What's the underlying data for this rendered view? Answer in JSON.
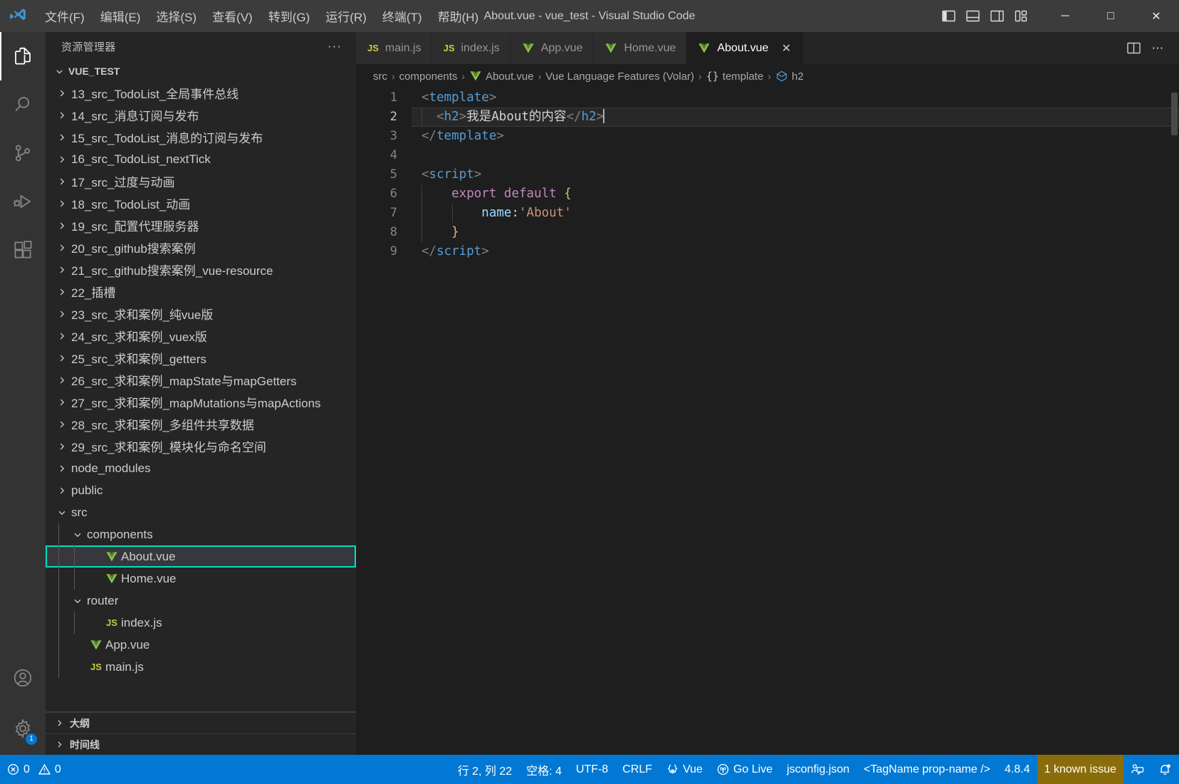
{
  "titlebar": {
    "title": "About.vue - vue_test - Visual Studio Code",
    "menus": [
      "文件(F)",
      "编辑(E)",
      "选择(S)",
      "查看(V)",
      "转到(G)",
      "运行(R)",
      "终端(T)",
      "帮助(H)"
    ],
    "layout_buttons": [
      {
        "name": "toggle-primary-sidebar",
        "label": "切换主侧栏"
      },
      {
        "name": "toggle-panel",
        "label": "切换面板"
      },
      {
        "name": "toggle-secondary-sidebar",
        "label": "切换辅助侧栏"
      },
      {
        "name": "customize-layout",
        "label": "自定义布局"
      }
    ],
    "window_buttons": [
      {
        "name": "minimize",
        "glyph": "─"
      },
      {
        "name": "maximize",
        "glyph": "□"
      },
      {
        "name": "close",
        "glyph": "✕"
      }
    ]
  },
  "activitybar": {
    "items": [
      {
        "name": "explorer",
        "icon": "files-icon",
        "active": true
      },
      {
        "name": "search",
        "icon": "search-icon",
        "active": false
      },
      {
        "name": "source-control",
        "icon": "source-control-icon",
        "active": false
      },
      {
        "name": "run-and-debug",
        "icon": "run-debug-icon",
        "active": false
      },
      {
        "name": "extensions",
        "icon": "extensions-icon",
        "active": false
      }
    ],
    "bottom": [
      {
        "name": "accounts",
        "icon": "account-icon",
        "badge": ""
      },
      {
        "name": "manage",
        "icon": "gear-icon",
        "badge": "1"
      }
    ]
  },
  "sidebar": {
    "header": "资源管理器",
    "more_actions": "···",
    "root": "VUE_TEST",
    "tree": [
      {
        "label": "13_src_TodoList_全局事件总线",
        "kind": "folder",
        "expanded": false,
        "depth": 1
      },
      {
        "label": "14_src_消息订阅与发布",
        "kind": "folder",
        "expanded": false,
        "depth": 1
      },
      {
        "label": "15_src_TodoList_消息的订阅与发布",
        "kind": "folder",
        "expanded": false,
        "depth": 1
      },
      {
        "label": "16_src_TodoList_nextTick",
        "kind": "folder",
        "expanded": false,
        "depth": 1
      },
      {
        "label": "17_src_过度与动画",
        "kind": "folder",
        "expanded": false,
        "depth": 1
      },
      {
        "label": "18_src_TodoList_动画",
        "kind": "folder",
        "expanded": false,
        "depth": 1
      },
      {
        "label": "19_src_配置代理服务器",
        "kind": "folder",
        "expanded": false,
        "depth": 1
      },
      {
        "label": "20_src_github搜索案例",
        "kind": "folder",
        "expanded": false,
        "depth": 1
      },
      {
        "label": "21_src_github搜索案例_vue-resource",
        "kind": "folder",
        "expanded": false,
        "depth": 1
      },
      {
        "label": "22_插槽",
        "kind": "folder",
        "expanded": false,
        "depth": 1
      },
      {
        "label": "23_src_求和案例_纯vue版",
        "kind": "folder",
        "expanded": false,
        "depth": 1
      },
      {
        "label": "24_src_求和案例_vuex版",
        "kind": "folder",
        "expanded": false,
        "depth": 1
      },
      {
        "label": "25_src_求和案例_getters",
        "kind": "folder",
        "expanded": false,
        "depth": 1
      },
      {
        "label": "26_src_求和案例_mapState与mapGetters",
        "kind": "folder",
        "expanded": false,
        "depth": 1
      },
      {
        "label": "27_src_求和案例_mapMutations与mapActions",
        "kind": "folder",
        "expanded": false,
        "depth": 1
      },
      {
        "label": "28_src_求和案例_多组件共享数据",
        "kind": "folder",
        "expanded": false,
        "depth": 1
      },
      {
        "label": "29_src_求和案例_模块化与命名空间",
        "kind": "folder",
        "expanded": false,
        "depth": 1
      },
      {
        "label": "node_modules",
        "kind": "folder",
        "expanded": false,
        "depth": 1
      },
      {
        "label": "public",
        "kind": "folder",
        "expanded": false,
        "depth": 1
      },
      {
        "label": "src",
        "kind": "folder",
        "expanded": true,
        "depth": 1
      },
      {
        "label": "components",
        "kind": "folder",
        "expanded": true,
        "depth": 2
      },
      {
        "label": "About.vue",
        "kind": "vue",
        "depth": 3,
        "selected": true
      },
      {
        "label": "Home.vue",
        "kind": "vue",
        "depth": 3
      },
      {
        "label": "router",
        "kind": "folder",
        "expanded": true,
        "depth": 2
      },
      {
        "label": "index.js",
        "kind": "js",
        "depth": 3
      },
      {
        "label": "App.vue",
        "kind": "vue",
        "depth": 2
      },
      {
        "label": "main.js",
        "kind": "js",
        "depth": 2
      }
    ],
    "panels": [
      {
        "label": "大纲",
        "expanded": false
      },
      {
        "label": "时间线",
        "expanded": false
      }
    ]
  },
  "tabs": [
    {
      "label": "main.js",
      "kind": "js",
      "active": false
    },
    {
      "label": "index.js",
      "kind": "js",
      "active": false
    },
    {
      "label": "App.vue",
      "kind": "vue",
      "active": false
    },
    {
      "label": "Home.vue",
      "kind": "vue",
      "active": false
    },
    {
      "label": "About.vue",
      "kind": "vue",
      "active": true,
      "close": "✕"
    }
  ],
  "tabbar_actions": [
    {
      "name": "split-editor-right",
      "icon": "split-editor-icon"
    },
    {
      "name": "editor-more-actions",
      "icon": "ellipsis-icon",
      "glyph": "⋯"
    }
  ],
  "breadcrumb": [
    {
      "label": "src",
      "icon": ""
    },
    {
      "label": "components",
      "icon": ""
    },
    {
      "label": "About.vue",
      "icon": "vue-icon"
    },
    {
      "label": "Vue Language Features (Volar)",
      "icon": ""
    },
    {
      "label": "template",
      "icon": "braces-icon"
    },
    {
      "label": "h2",
      "icon": "symbol-cube-icon"
    }
  ],
  "editor": {
    "lines": [
      {
        "n": "1",
        "tokens": [
          {
            "t": "<",
            "c": "punct"
          },
          {
            "t": "template",
            "c": "tag"
          },
          {
            "t": ">",
            "c": "punct"
          }
        ]
      },
      {
        "n": "2",
        "active": true,
        "indent": 1,
        "tokens": [
          {
            "t": "  ",
            "c": "txt"
          },
          {
            "t": "<",
            "c": "punct"
          },
          {
            "t": "h2",
            "c": "tag"
          },
          {
            "t": ">",
            "c": "punct"
          },
          {
            "t": "我是About的内容",
            "c": "txt"
          },
          {
            "t": "</",
            "c": "punct"
          },
          {
            "t": "h2",
            "c": "tag"
          },
          {
            "t": ">",
            "c": "punct"
          }
        ]
      },
      {
        "n": "3",
        "tokens": [
          {
            "t": "</",
            "c": "punct"
          },
          {
            "t": "template",
            "c": "tag"
          },
          {
            "t": ">",
            "c": "punct"
          }
        ]
      },
      {
        "n": "4",
        "tokens": []
      },
      {
        "n": "5",
        "tokens": [
          {
            "t": "<",
            "c": "punct"
          },
          {
            "t": "script",
            "c": "tag"
          },
          {
            "t": ">",
            "c": "punct"
          }
        ]
      },
      {
        "n": "6",
        "indent": 1,
        "tokens": [
          {
            "t": "    ",
            "c": "txt"
          },
          {
            "t": "export",
            "c": "kw"
          },
          {
            "t": " ",
            "c": "txt"
          },
          {
            "t": "default",
            "c": "kw"
          },
          {
            "t": " ",
            "c": "txt"
          },
          {
            "t": "{",
            "c": "brace-y"
          }
        ]
      },
      {
        "n": "7",
        "indent": 2,
        "tokens": [
          {
            "t": "        ",
            "c": "txt"
          },
          {
            "t": "name",
            "c": "prop"
          },
          {
            "t": ":",
            "c": "txt"
          },
          {
            "t": "'About'",
            "c": "str"
          }
        ]
      },
      {
        "n": "8",
        "indent": 1,
        "tokens": [
          {
            "t": "    ",
            "c": "txt"
          },
          {
            "t": "}",
            "c": "brace-y"
          }
        ]
      },
      {
        "n": "9",
        "tokens": [
          {
            "t": "</",
            "c": "punct"
          },
          {
            "t": "script",
            "c": "tag"
          },
          {
            "t": ">",
            "c": "punct"
          }
        ]
      }
    ]
  },
  "statusbar": {
    "left": [
      {
        "name": "problems",
        "icon": "error-icon",
        "label": "0",
        "icon2": "warning-icon",
        "label2": "0"
      }
    ],
    "right": [
      {
        "name": "editor-position",
        "label": "行 2, 列 22"
      },
      {
        "name": "editor-indentation",
        "label": "空格: 4"
      },
      {
        "name": "editor-encoding",
        "label": "UTF-8"
      },
      {
        "name": "editor-eol",
        "label": "CRLF"
      },
      {
        "name": "editor-language",
        "label": "Vue",
        "icon": "braces-error-icon"
      },
      {
        "name": "go-live",
        "label": "Go Live",
        "icon": "broadcast-icon"
      },
      {
        "name": "tsconfig",
        "label": "jsconfig.json"
      },
      {
        "name": "vue-tagname",
        "label": "<TagName prop-name />"
      },
      {
        "name": "typescript-version",
        "label": "4.8.4"
      },
      {
        "name": "known-issues",
        "label": "1 known issue",
        "warn": true
      },
      {
        "name": "feedback",
        "icon": "feedback-icon",
        "label": ""
      },
      {
        "name": "notifications",
        "icon": "bell-icon",
        "label": ""
      }
    ]
  },
  "colors": {
    "accent": "#0078d4",
    "selection_border": "#00e0c0",
    "warn_bg": "#8a6d0b",
    "vue_green": "#8dc149",
    "js_yellow": "#cbcb41",
    "tag_blue": "#569cd6",
    "string_orange": "#ce9178",
    "keyword_purple": "#c586c0"
  }
}
